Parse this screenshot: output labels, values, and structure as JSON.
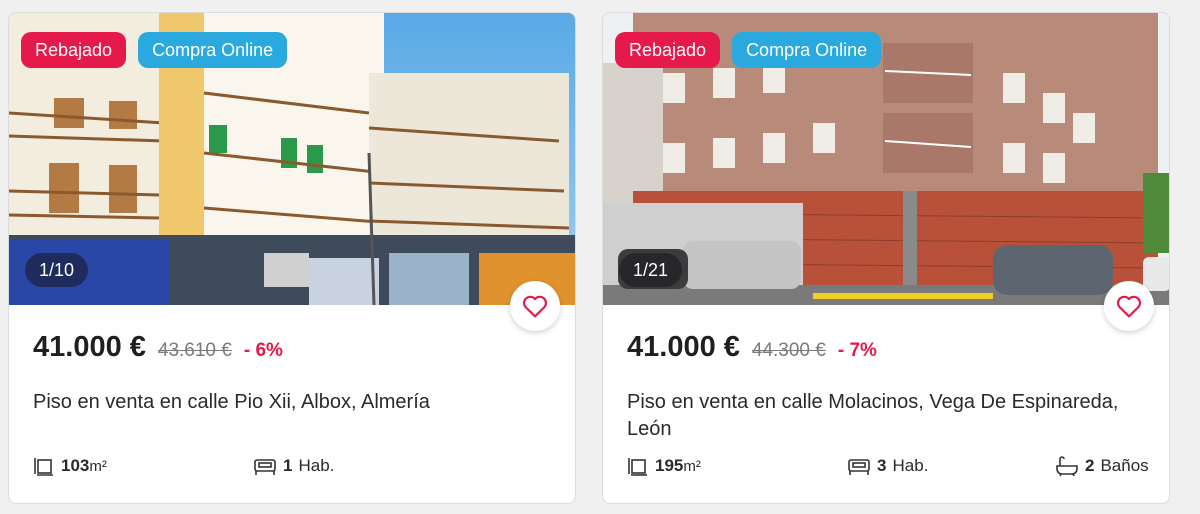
{
  "listings": [
    {
      "badges": {
        "sale": "Rebajado",
        "online": "Compra Online"
      },
      "photo_counter": "1/10",
      "price": "41.000 €",
      "old_price": "43.610 €",
      "discount": "- 6%",
      "title": "Piso en venta en calle Pio Xii, Albox, Almería",
      "features": {
        "area_value": "103",
        "area_unit": "m²",
        "rooms_value": "1",
        "rooms_label": "Hab."
      }
    },
    {
      "badges": {
        "sale": "Rebajado",
        "online": "Compra Online"
      },
      "photo_counter": "1/21",
      "price": "41.000 €",
      "old_price": "44.300 €",
      "discount": "- 7%",
      "title": "Piso en venta en calle Molacinos, Vega De Espinareda, León",
      "features": {
        "area_value": "195",
        "area_unit": "m²",
        "rooms_value": "3",
        "rooms_label": "Hab.",
        "baths_value": "2",
        "baths_label": "Baños"
      }
    }
  ],
  "icons": [
    "area-icon",
    "bed-icon",
    "bath-icon",
    "heart-icon"
  ],
  "colors": {
    "sale_badge": "#e6194b",
    "online_badge": "#29a9de",
    "discount": "#e6194b",
    "heart": "#e6194b"
  }
}
